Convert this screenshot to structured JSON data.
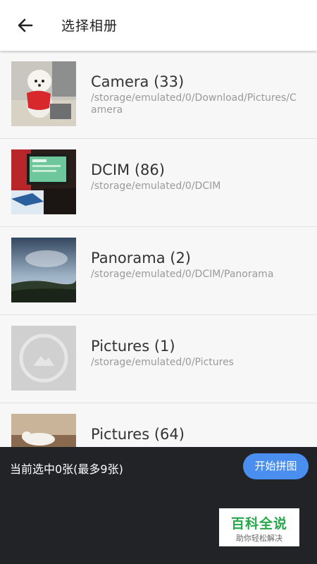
{
  "header": {
    "title": "选择相册"
  },
  "albums": [
    {
      "name": "Camera (33)",
      "path": "/storage/emulated/0/Download/Pictures/Camera"
    },
    {
      "name": "DCIM (86)",
      "path": "/storage/emulated/0/DCIM"
    },
    {
      "name": "Panorama (2)",
      "path": "/storage/emulated/0/DCIM/Panorama"
    },
    {
      "name": "Pictures (1)",
      "path": "/storage/emulated/0/Pictures"
    },
    {
      "name": "Pictures (64)",
      "path": ""
    }
  ],
  "footer": {
    "selection_text": "当前选中0张(最多9张)",
    "start_button": "开始拼图"
  },
  "watermark": {
    "title": "百科全说",
    "subtitle": "助你轻松解决"
  },
  "colors": {
    "accent": "#4a8ff0",
    "bottom_bar": "#222326",
    "watermark_green": "#27a84a"
  }
}
